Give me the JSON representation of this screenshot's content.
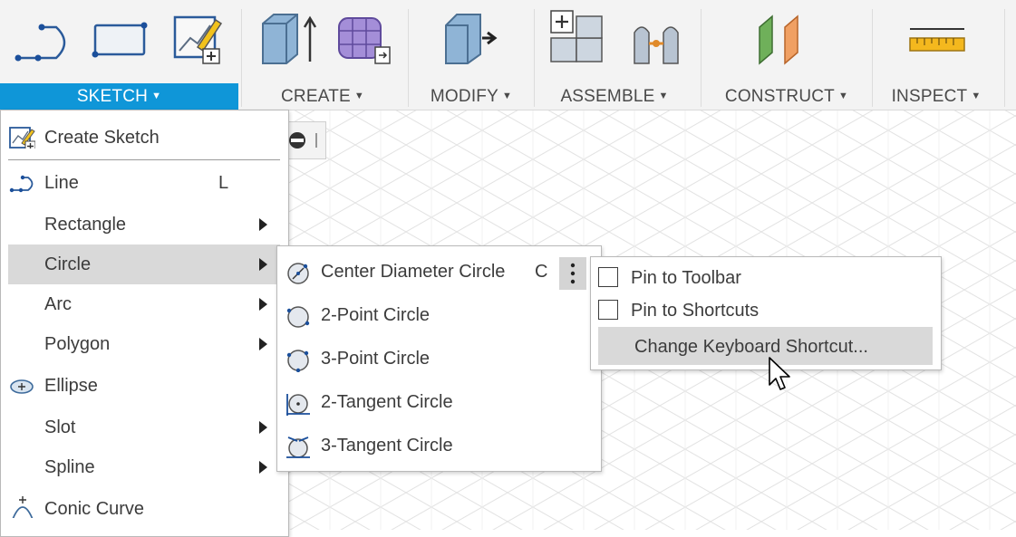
{
  "toolbar": {
    "groups": [
      {
        "label": "SKETCH",
        "active": true
      },
      {
        "label": "CREATE",
        "active": false
      },
      {
        "label": "MODIFY",
        "active": false
      },
      {
        "label": "ASSEMBLE",
        "active": false
      },
      {
        "label": "CONSTRUCT",
        "active": false
      },
      {
        "label": "INSPECT",
        "active": false
      }
    ],
    "caret": "▼",
    "icons": [
      "line-tool-icon",
      "rectangle-tool-icon",
      "create-sketch-icon",
      "extrude-icon",
      "create-form-icon",
      "press-pull-icon",
      "new-component-icon",
      "joint-icon",
      "offset-plane-icon",
      "measure-icon"
    ]
  },
  "colors": {
    "accent": "#0f96d8",
    "highlight": "#d9d9d9",
    "toolbar_bg": "#f3f3f3",
    "grid": "#e6e6e6"
  },
  "sketch_menu": {
    "items": [
      {
        "label": "Create Sketch",
        "shortcut": "",
        "icon": "create-sketch-icon",
        "submenu": false
      },
      {
        "label": "Line",
        "shortcut": "L",
        "icon": "line-icon",
        "submenu": false
      },
      {
        "label": "Rectangle",
        "shortcut": "",
        "icon": "",
        "submenu": true
      },
      {
        "label": "Circle",
        "shortcut": "",
        "icon": "",
        "submenu": true,
        "highlighted": true
      },
      {
        "label": "Arc",
        "shortcut": "",
        "icon": "",
        "submenu": true
      },
      {
        "label": "Polygon",
        "shortcut": "",
        "icon": "",
        "submenu": true
      },
      {
        "label": "Ellipse",
        "shortcut": "",
        "icon": "ellipse-icon",
        "submenu": false
      },
      {
        "label": "Slot",
        "shortcut": "",
        "icon": "",
        "submenu": true
      },
      {
        "label": "Spline",
        "shortcut": "",
        "icon": "",
        "submenu": true
      },
      {
        "label": "Conic Curve",
        "shortcut": "",
        "icon": "conic-curve-icon",
        "submenu": false
      }
    ]
  },
  "circle_submenu": {
    "items": [
      {
        "label": "Center Diameter Circle",
        "shortcut": "C",
        "icon": "center-diameter-circle-icon"
      },
      {
        "label": "2-Point Circle",
        "shortcut": "",
        "icon": "two-point-circle-icon"
      },
      {
        "label": "3-Point Circle",
        "shortcut": "",
        "icon": "three-point-circle-icon"
      },
      {
        "label": "2-Tangent Circle",
        "shortcut": "",
        "icon": "two-tangent-circle-icon"
      },
      {
        "label": "3-Tangent Circle",
        "shortcut": "",
        "icon": "three-tangent-circle-icon"
      }
    ]
  },
  "context_menu": {
    "pin_toolbar": "Pin to Toolbar",
    "pin_shortcuts": "Pin to Shortcuts",
    "change_shortcut": "Change Keyboard Shortcut...",
    "pin_toolbar_checked": false,
    "pin_shortcuts_checked": false
  }
}
